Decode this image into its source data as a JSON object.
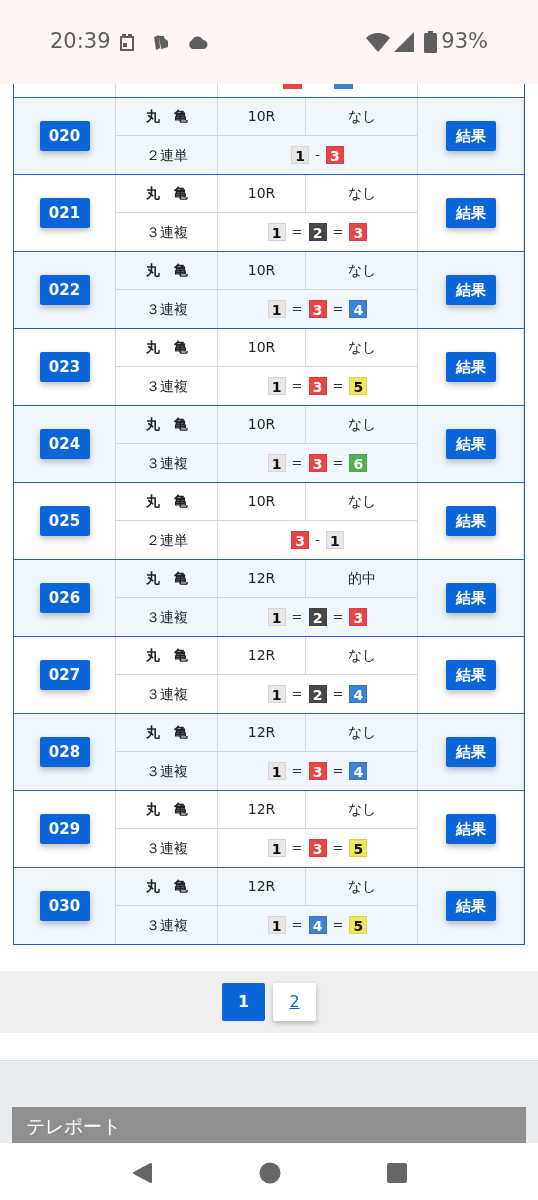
{
  "status_bar": {
    "time": "20:39",
    "battery": "93%"
  },
  "partial_row": {
    "tiles": [
      {
        "color": "#e84545"
      },
      {
        "color": "#3f82d4"
      }
    ]
  },
  "rows": [
    {
      "id": "020",
      "venue": "丸　亀",
      "race": "10R",
      "outcome": "なし",
      "bet_type": "２連単",
      "tiles": [
        {
          "num": "1",
          "color": "#e8e8e8"
        },
        {
          "num": "3",
          "color": "#e84545"
        }
      ],
      "sep": "-",
      "button": "結果"
    },
    {
      "id": "021",
      "venue": "丸　亀",
      "race": "10R",
      "outcome": "なし",
      "bet_type": "３連複",
      "tiles": [
        {
          "num": "1",
          "color": "#e8e8e8"
        },
        {
          "num": "2",
          "color": "#484848"
        },
        {
          "num": "3",
          "color": "#e84545"
        }
      ],
      "sep": "=",
      "button": "結果"
    },
    {
      "id": "022",
      "venue": "丸　亀",
      "race": "10R",
      "outcome": "なし",
      "bet_type": "３連複",
      "tiles": [
        {
          "num": "1",
          "color": "#e8e8e8"
        },
        {
          "num": "3",
          "color": "#e84545"
        },
        {
          "num": "4",
          "color": "#3f82d4"
        }
      ],
      "sep": "=",
      "button": "結果"
    },
    {
      "id": "023",
      "venue": "丸　亀",
      "race": "10R",
      "outcome": "なし",
      "bet_type": "３連複",
      "tiles": [
        {
          "num": "1",
          "color": "#e8e8e8"
        },
        {
          "num": "3",
          "color": "#e84545"
        },
        {
          "num": "5",
          "color": "#efe65a"
        }
      ],
      "sep": "=",
      "button": "結果"
    },
    {
      "id": "024",
      "venue": "丸　亀",
      "race": "10R",
      "outcome": "なし",
      "bet_type": "３連複",
      "tiles": [
        {
          "num": "1",
          "color": "#e8e8e8"
        },
        {
          "num": "3",
          "color": "#e84545"
        },
        {
          "num": "6",
          "color": "#4fb34f"
        }
      ],
      "sep": "=",
      "button": "結果"
    },
    {
      "id": "025",
      "venue": "丸　亀",
      "race": "10R",
      "outcome": "なし",
      "bet_type": "２連単",
      "tiles": [
        {
          "num": "3",
          "color": "#e84545"
        },
        {
          "num": "1",
          "color": "#e8e8e8"
        }
      ],
      "sep": "-",
      "button": "結果"
    },
    {
      "id": "026",
      "venue": "丸　亀",
      "race": "12R",
      "outcome": "的中",
      "bet_type": "３連複",
      "tiles": [
        {
          "num": "1",
          "color": "#e8e8e8"
        },
        {
          "num": "2",
          "color": "#484848"
        },
        {
          "num": "3",
          "color": "#e84545"
        }
      ],
      "sep": "=",
      "button": "結果"
    },
    {
      "id": "027",
      "venue": "丸　亀",
      "race": "12R",
      "outcome": "なし",
      "bet_type": "３連複",
      "tiles": [
        {
          "num": "1",
          "color": "#e8e8e8"
        },
        {
          "num": "2",
          "color": "#484848"
        },
        {
          "num": "4",
          "color": "#3f82d4"
        }
      ],
      "sep": "=",
      "button": "結果"
    },
    {
      "id": "028",
      "venue": "丸　亀",
      "race": "12R",
      "outcome": "なし",
      "bet_type": "３連複",
      "tiles": [
        {
          "num": "1",
          "color": "#e8e8e8"
        },
        {
          "num": "3",
          "color": "#e84545"
        },
        {
          "num": "4",
          "color": "#3f82d4"
        }
      ],
      "sep": "=",
      "button": "結果"
    },
    {
      "id": "029",
      "venue": "丸　亀",
      "race": "12R",
      "outcome": "なし",
      "bet_type": "３連複",
      "tiles": [
        {
          "num": "1",
          "color": "#e8e8e8"
        },
        {
          "num": "3",
          "color": "#e84545"
        },
        {
          "num": "5",
          "color": "#efe65a"
        }
      ],
      "sep": "=",
      "button": "結果"
    },
    {
      "id": "030",
      "venue": "丸　亀",
      "race": "12R",
      "outcome": "なし",
      "bet_type": "３連複",
      "tiles": [
        {
          "num": "1",
          "color": "#e8e8e8"
        },
        {
          "num": "4",
          "color": "#3f82d4"
        },
        {
          "num": "5",
          "color": "#efe65a"
        }
      ],
      "sep": "=",
      "button": "結果"
    }
  ],
  "pagination": [
    {
      "label": "1",
      "selected": true
    },
    {
      "label": "2",
      "selected": false
    }
  ],
  "teleport_heading": "テレポート"
}
